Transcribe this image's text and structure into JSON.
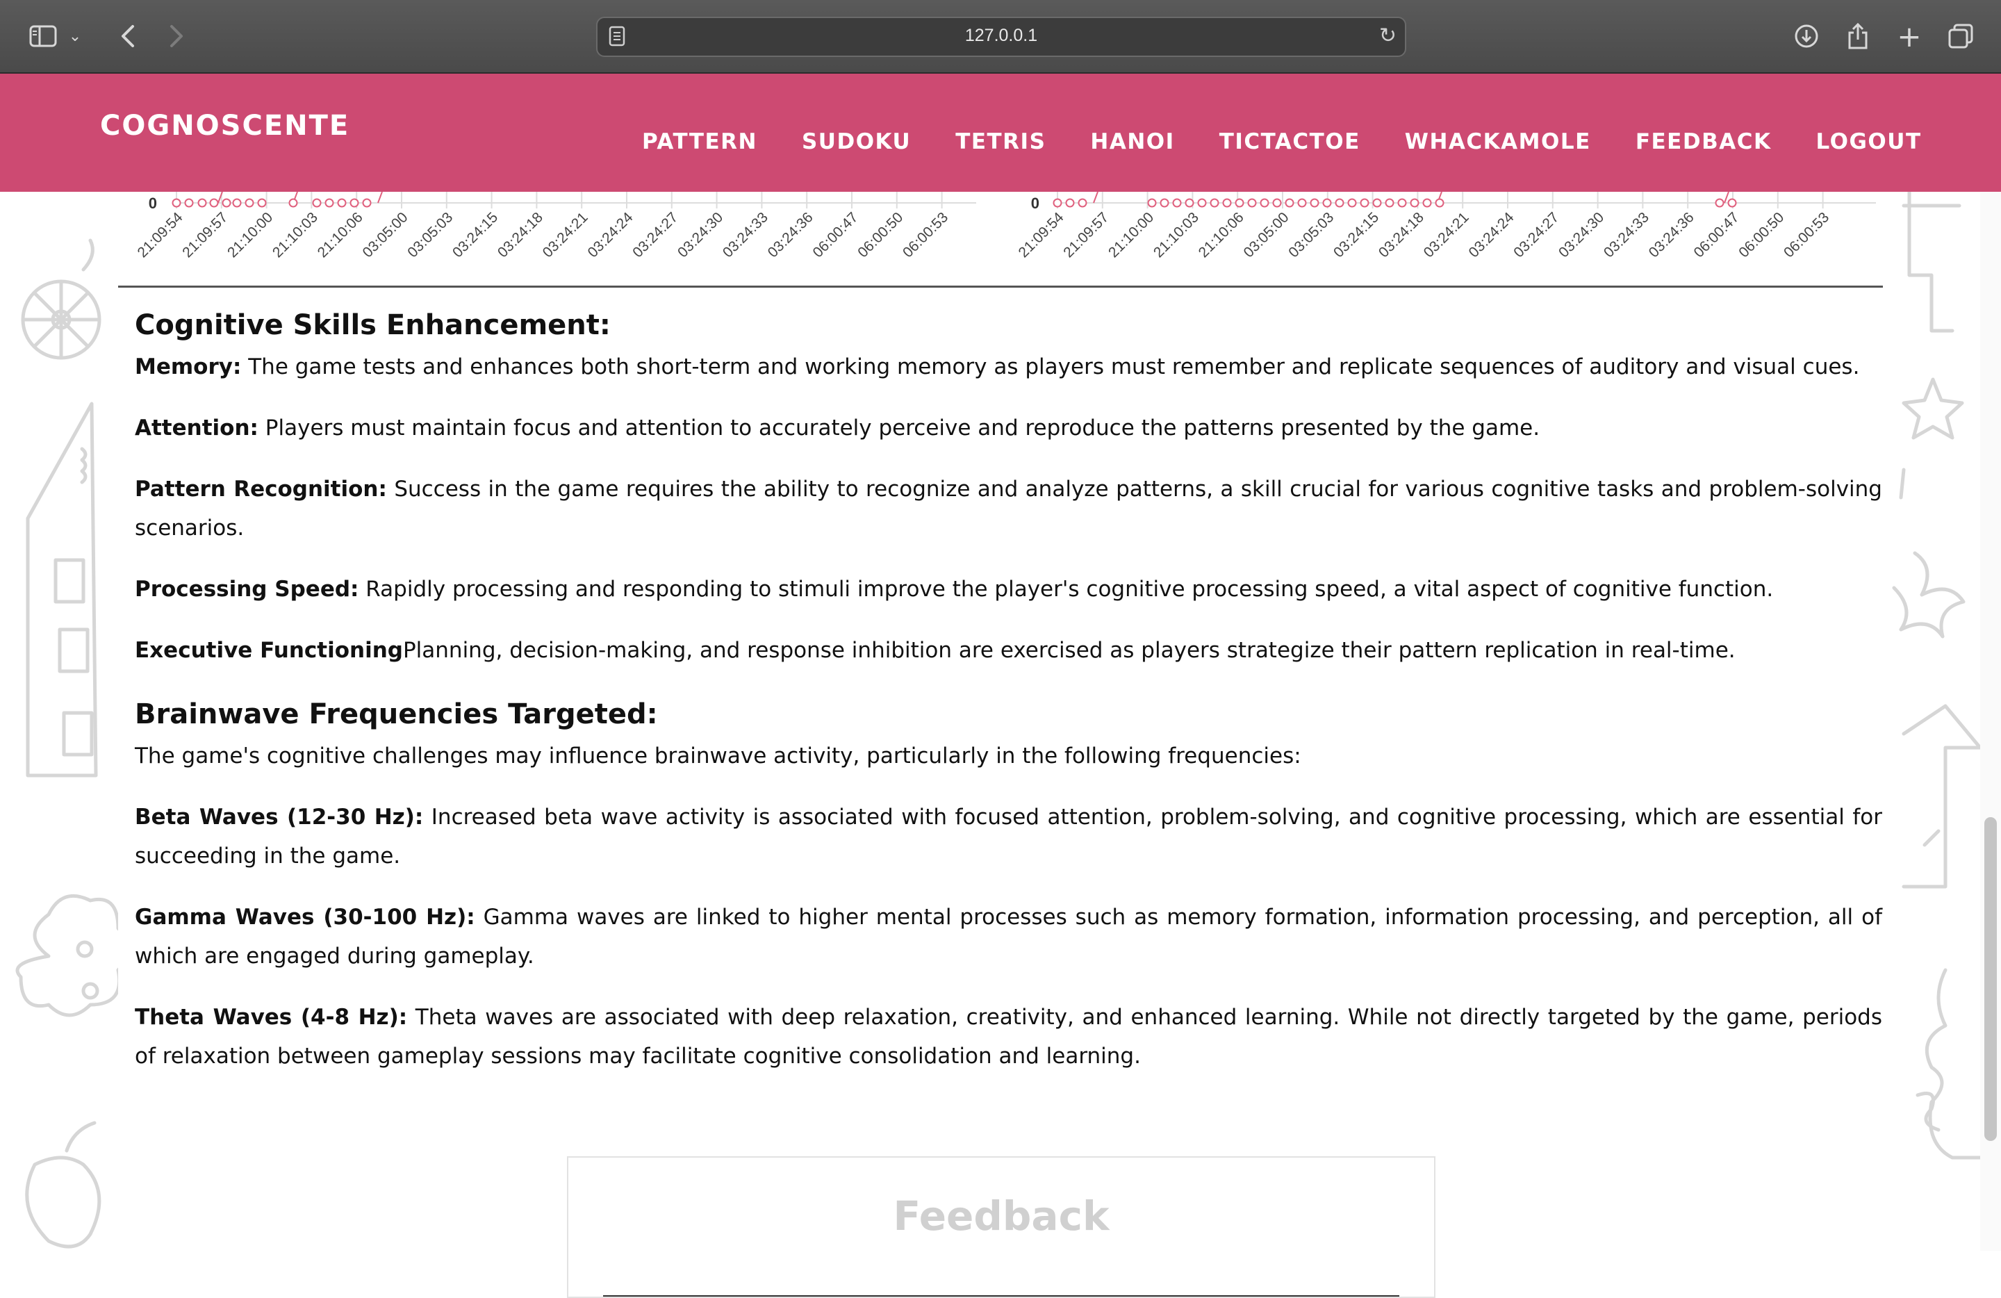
{
  "browser": {
    "url": "127.0.0.1",
    "icons": {
      "sidebar": "sidebar-icon",
      "chevron": "chevron-down-icon",
      "back": "back-arrow-icon",
      "forward": "forward-arrow-icon",
      "reader": "page-icon",
      "reload": "reload-icon",
      "download": "download-icon",
      "share": "share-icon",
      "new_tab": "plus-icon",
      "tabs": "tabs-icon"
    }
  },
  "nav": {
    "brand": "COGNOSCENTE",
    "links": [
      "PATTERN",
      "SUDOKU",
      "TETRIS",
      "HANOI",
      "TICTACTOE",
      "WHACKAMOLE",
      "FEEDBACK",
      "LOGOUT"
    ],
    "color": "#cd4a72"
  },
  "chart_data": [
    {
      "type": "line",
      "y_tick_visible": "0",
      "x": [
        "21:09:54",
        "21:09:57",
        "21:10:00",
        "21:10:03",
        "21:10:06",
        "03:05:00",
        "03:05:03",
        "03:24:15",
        "03:24:18",
        "03:24:21",
        "03:24:24",
        "03:24:27",
        "03:24:30",
        "03:24:33",
        "03:24:36",
        "06:00:47",
        "06:00:50",
        "06:00:53"
      ],
      "series_color": "#e0607e"
    },
    {
      "type": "line",
      "y_tick_visible": "0",
      "x": [
        "21:09:54",
        "21:09:57",
        "21:10:00",
        "21:10:03",
        "21:10:06",
        "03:05:00",
        "03:05:03",
        "03:24:15",
        "03:24:18",
        "03:24:21",
        "03:24:24",
        "03:24:27",
        "03:24:30",
        "03:24:33",
        "03:24:36",
        "06:00:47",
        "06:00:50",
        "06:00:53"
      ],
      "series_color": "#e0607e"
    }
  ],
  "skills": {
    "heading": "Cognitive Skills Enhancement:",
    "items": [
      {
        "term": "Memory:",
        "text": " The game tests and enhances both short-term and working memory as players must remember and replicate sequences of auditory and visual cues."
      },
      {
        "term": "Attention:",
        "text": " Players must maintain focus and attention to accurately perceive and reproduce the patterns presented by the game."
      },
      {
        "term": "Pattern Recognition:",
        "text": " Success in the game requires the ability to recognize and analyze patterns, a skill crucial for various cognitive tasks and problem-solving scenarios."
      },
      {
        "term": "Processing Speed:",
        "text": " Rapidly processing and responding to stimuli improve the player's cognitive processing speed, a vital aspect of cognitive function."
      },
      {
        "term": "Executive Functioning",
        "text": "Planning, decision-making, and response inhibition are exercised as players strategize their pattern replication in real-time."
      }
    ]
  },
  "brainwaves": {
    "heading": "Brainwave Frequencies Targeted:",
    "intro": "The game's cognitive challenges may influence brainwave activity, particularly in the following frequencies:",
    "items": [
      {
        "term": "Beta Waves (12-30 Hz):",
        "text": " Increased beta wave activity is associated with focused attention, problem-solving, and cognitive processing, which are essential for succeeding in the game."
      },
      {
        "term": "Gamma Waves (30-100 Hz):",
        "text": " Gamma waves are linked to higher mental processes such as memory formation, information processing, and perception, all of which are engaged during gameplay."
      },
      {
        "term": "Theta Waves (4-8 Hz):",
        "text": " Theta waves are associated with deep relaxation, creativity, and enhanced learning. While not directly targeted by the game, periods of relaxation between gameplay sessions may facilitate cognitive consolidation and learning."
      }
    ]
  },
  "feedback": {
    "title": "Feedback"
  }
}
